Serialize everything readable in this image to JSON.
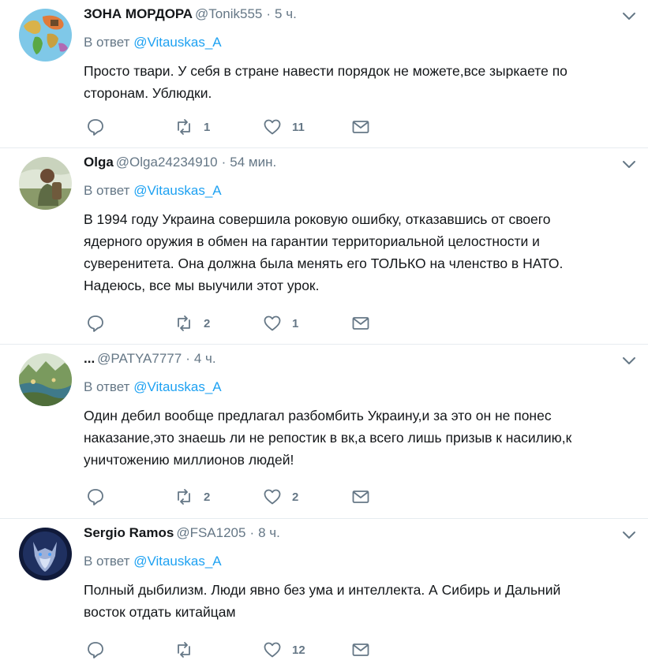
{
  "reply_prefix": "В ответ",
  "tweets": [
    {
      "name": "ЗОНА МОРДОРА",
      "handle": "@Tonik555",
      "time": "5 ч.",
      "reply_to": "@Vitauskas_A",
      "lines": [
        "Просто твари. У себя в стране навести порядок не можете,все зыркаете по",
        "сторонам. Ублюдки."
      ],
      "retweets": "1",
      "likes": "11",
      "avatar_icon": "world-map-avatar"
    },
    {
      "name": "Olga",
      "handle": "@Olga24234910",
      "time": "54 мин.",
      "reply_to": "@Vitauskas_A",
      "lines": [
        "В 1994 году Украина совершила роковую ошибку, отказавшись от своего",
        "ядерного оружия в обмен на гарантии территориальной целостности и",
        "суверенитета. Она должна была менять его ТОЛЬКО на членство в НАТО.",
        "Надеюсь, все мы выучили этот урок."
      ],
      "retweets": "2",
      "likes": "1",
      "avatar_icon": "person-outdoors-avatar"
    },
    {
      "name": "...",
      "handle": "@PATYA7777",
      "time": "4 ч.",
      "reply_to": "@Vitauskas_A",
      "lines": [
        "Один дебил вообще предлагал разбомбить Украину,и за это он не понес",
        "наказание,это знаешь ли не репостик в вк,а всего лишь призыв к насилию,к",
        "уничтожению миллионов людей!"
      ],
      "retweets": "2",
      "likes": "2",
      "avatar_icon": "landscape-avatar"
    },
    {
      "name": "Sergio Ramos",
      "handle": "@FSA1205",
      "time": "8 ч.",
      "reply_to": "@Vitauskas_A",
      "lines": [
        "Полный дыбилизм. Люди явно без ума и интеллекта. А Сибирь и Дальний",
        "восток отдать китайцам"
      ],
      "retweets": "",
      "likes": "12",
      "avatar_icon": "wolf-avatar"
    }
  ],
  "colors": {
    "link": "#1da1f2",
    "muted": "#657786",
    "text": "#14171a",
    "divider": "#e6ecf0"
  }
}
